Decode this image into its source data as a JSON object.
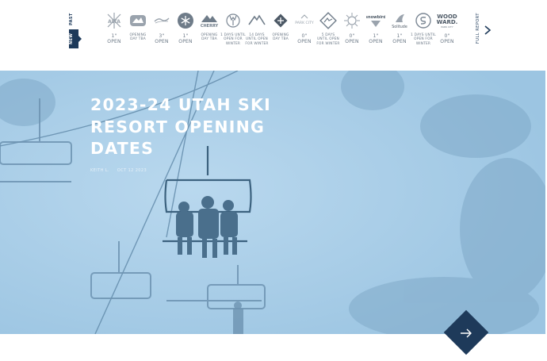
{
  "tabs": {
    "past_label": "PAST",
    "new_label": "NEW"
  },
  "resorts": [
    {
      "logo": "alta-logo",
      "line1": "1\"",
      "line2": "OPEN",
      "line3": ""
    },
    {
      "logo": "beaver-mountain-logo",
      "line1": "OPENING",
      "line2": "DAY TBA",
      "line3": ""
    },
    {
      "logo": "brighton-logo",
      "line1": "3\"",
      "line2": "OPEN",
      "line3": ""
    },
    {
      "logo": "brian-head-logo",
      "line1": "1\"",
      "line2": "OPEN",
      "line3": ""
    },
    {
      "logo": "cherry-peak-logo",
      "line1": "OPENING",
      "line2": "DAY TBA",
      "line3": ""
    },
    {
      "logo": "deer-valley-logo",
      "line1": "1 DAYS UNTIL",
      "line2": "OPEN FOR",
      "line3": "WINTER"
    },
    {
      "logo": "eagle-point-logo",
      "line1": "14 DAYS",
      "line2": "UNTIL OPEN",
      "line3": "FOR WINTER"
    },
    {
      "logo": "nordic-valley-logo",
      "line1": "OPENING",
      "line2": "DAY TBA",
      "line3": ""
    },
    {
      "logo": "park-city-logo",
      "line1": "0\"",
      "line2": "OPEN",
      "line3": ""
    },
    {
      "logo": "powder-mountain-logo",
      "line1": "5 DAYS",
      "line2": "UNTIL OPEN",
      "line3": "FOR WINTER"
    },
    {
      "logo": "snowbasin-logo",
      "line1": "0\"",
      "line2": "OPEN",
      "line3": ""
    },
    {
      "logo": "snowbird-logo",
      "line1": "1\"",
      "line2": "OPEN",
      "line3": ""
    },
    {
      "logo": "solitude-logo",
      "line1": "1\"",
      "line2": "OPEN",
      "line3": ""
    },
    {
      "logo": "sundance-logo",
      "line1": "1 DAYS UNTIL",
      "line2": "OPEN FOR",
      "line3": "WINTER"
    },
    {
      "logo": "woodward-logo",
      "line1": "0\"",
      "line2": "OPEN",
      "line3": ""
    }
  ],
  "logo_text": {
    "alta": "ALTA",
    "beaver": "Beaver",
    "cherry": "CHERRY",
    "park_city": "PARK CITY",
    "snowbird": "snowbird",
    "solitude": "Solitude",
    "woodward_1": "WOOD",
    "woodward_2": "WARD.",
    "woodward_3": "PARK CITY"
  },
  "full_report_label": "FULL REPORT",
  "article": {
    "title": "2023-24 UTAH SKI RESORT OPENING DATES",
    "author": "KEITH L.",
    "date": "OCT 12 2023"
  },
  "colors": {
    "navy": "#1e3a5a",
    "sky": "#a7cce6",
    "status_gray": "#6a7785"
  }
}
